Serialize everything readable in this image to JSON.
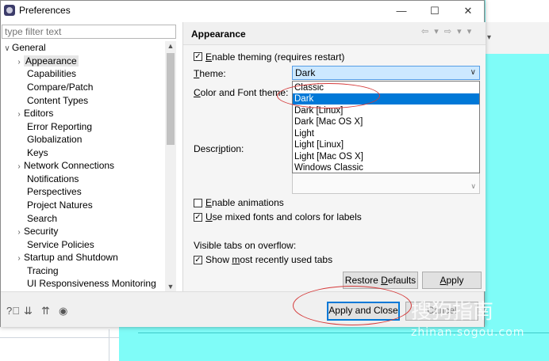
{
  "window": {
    "title": "Preferences",
    "minimize": "—",
    "maximize": "☐",
    "close": "✕"
  },
  "sidebar": {
    "filter_placeholder": "type filter text",
    "items": [
      {
        "label": "General",
        "arrow": "∨"
      },
      {
        "label": "Appearance",
        "arrow": "›"
      },
      {
        "label": "Capabilities",
        "arrow": ""
      },
      {
        "label": "Compare/Patch",
        "arrow": ""
      },
      {
        "label": "Content Types",
        "arrow": ""
      },
      {
        "label": "Editors",
        "arrow": "›"
      },
      {
        "label": "Error Reporting",
        "arrow": ""
      },
      {
        "label": "Globalization",
        "arrow": ""
      },
      {
        "label": "Keys",
        "arrow": ""
      },
      {
        "label": "Network Connections",
        "arrow": "›"
      },
      {
        "label": "Notifications",
        "arrow": ""
      },
      {
        "label": "Perspectives",
        "arrow": ""
      },
      {
        "label": "Project Natures",
        "arrow": ""
      },
      {
        "label": "Search",
        "arrow": ""
      },
      {
        "label": "Security",
        "arrow": "›"
      },
      {
        "label": "Service Policies",
        "arrow": ""
      },
      {
        "label": "Startup and Shutdown",
        "arrow": "›"
      },
      {
        "label": "Tracing",
        "arrow": ""
      },
      {
        "label": "UI Responsiveness Monitoring",
        "arrow": ""
      }
    ]
  },
  "pane": {
    "title": "Appearance",
    "nav": "⇦ ▾ ⇨ ▾ ▾",
    "enable_theming": {
      "pre": "",
      "mn": "E",
      "post": "nable theming (requires restart)"
    },
    "theme_label": {
      "mn": "T",
      "post": "heme:"
    },
    "color_font_theme_label": {
      "mn": "C",
      "post": "olor and Font theme:"
    },
    "theme_value": "Dark",
    "theme_options": [
      "Classic",
      "Dark",
      "Dark [Linux]",
      "Dark [Mac OS X]",
      "Light",
      "Light [Linux]",
      "Light [Mac OS X]",
      "Windows Classic"
    ],
    "description_label": {
      "pre": "Descr",
      "mn": "i",
      "post": "ption:"
    },
    "enable_animations": {
      "mn": "E",
      "post": "nable animations"
    },
    "mixed_fonts": {
      "mn": "U",
      "post": "se mixed fonts and colors for labels"
    },
    "visible_tabs_label": "Visible tabs on overflow:",
    "show_recent": {
      "pre": "Show ",
      "mn": "m",
      "post": "ost recently used tabs"
    },
    "restore_defaults": {
      "pre": "Restore ",
      "mn": "D",
      "post": "efaults"
    },
    "apply": {
      "mn": "A",
      "post": "pply"
    }
  },
  "footer": {
    "apply_close": "Apply and Close",
    "cancel": "Cancel"
  },
  "watermark": {
    "line1": "搜狗指南",
    "line2": "zhinan.sogou.com"
  },
  "colors": {
    "selection": "#0078d7",
    "annotation": "#d53a3a",
    "background": "#7ffcf8"
  }
}
